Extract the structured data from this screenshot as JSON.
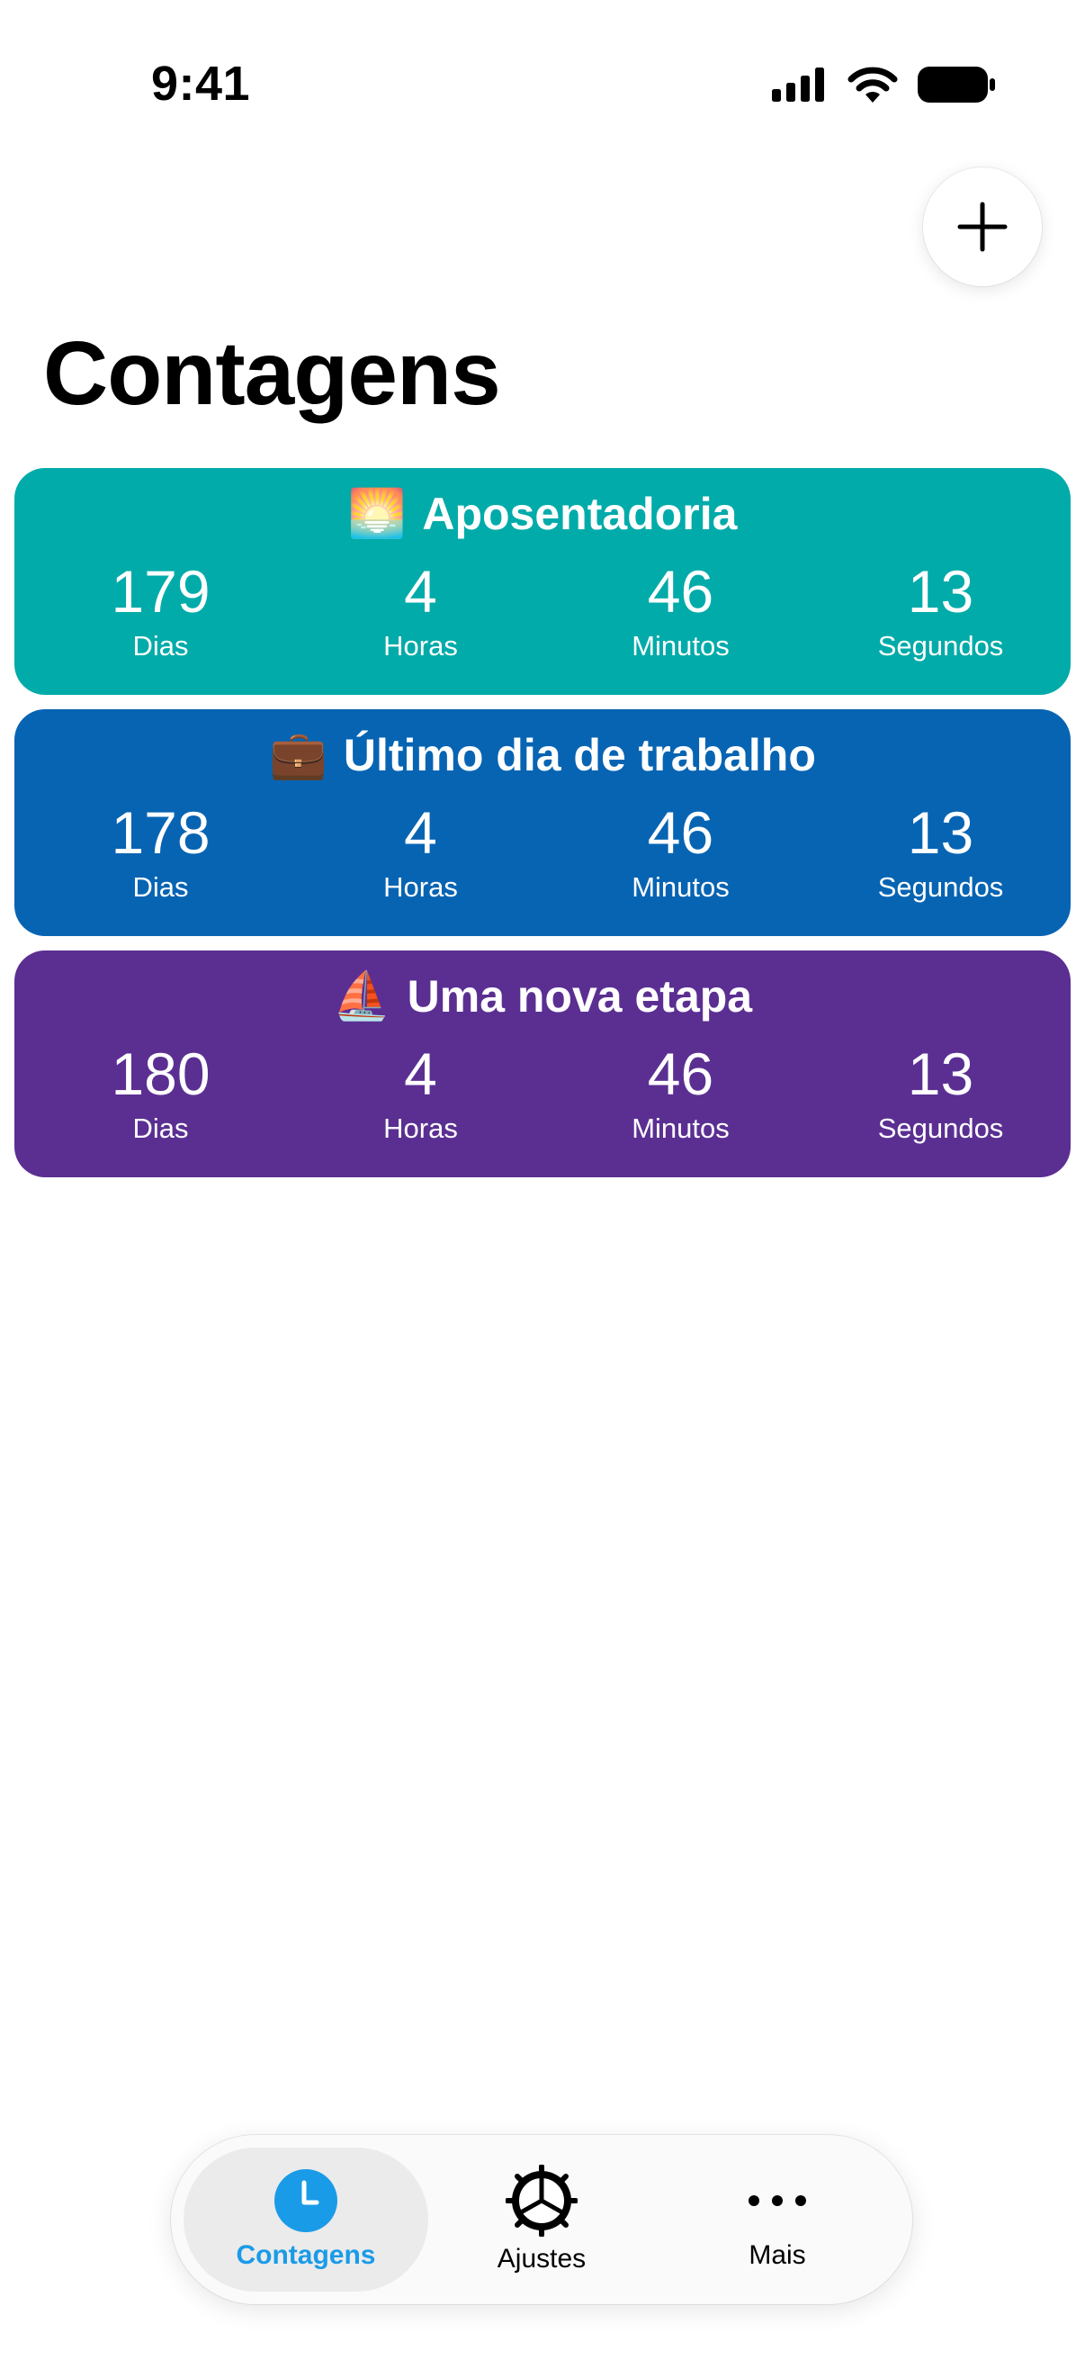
{
  "status_bar": {
    "time": "9:41"
  },
  "header": {
    "title": "Contagens",
    "add_icon": "plus-icon"
  },
  "colors": {
    "teal": "#00ABA9",
    "blue": "#0764B3",
    "purple": "#5B2F92",
    "accent": "#1A9BE8"
  },
  "countdowns": [
    {
      "emoji": "🌅",
      "title": "Aposentadoria",
      "color": "#00ABA9",
      "units": [
        {
          "value": "179",
          "label": "Dias"
        },
        {
          "value": "4",
          "label": "Horas"
        },
        {
          "value": "46",
          "label": "Minutos"
        },
        {
          "value": "13",
          "label": "Segundos"
        }
      ]
    },
    {
      "emoji": "💼",
      "title": "Último dia de trabalho",
      "color": "#0764B3",
      "units": [
        {
          "value": "178",
          "label": "Dias"
        },
        {
          "value": "4",
          "label": "Horas"
        },
        {
          "value": "46",
          "label": "Minutos"
        },
        {
          "value": "13",
          "label": "Segundos"
        }
      ]
    },
    {
      "emoji": "⛵",
      "title": "Uma nova etapa",
      "color": "#5B2F92",
      "units": [
        {
          "value": "180",
          "label": "Dias"
        },
        {
          "value": "4",
          "label": "Horas"
        },
        {
          "value": "46",
          "label": "Minutos"
        },
        {
          "value": "13",
          "label": "Segundos"
        }
      ]
    }
  ],
  "tab_bar": {
    "tabs": [
      {
        "label": "Contagens",
        "icon": "clock-icon",
        "active": true
      },
      {
        "label": "Ajustes",
        "icon": "gear-icon",
        "active": false
      },
      {
        "label": "Mais",
        "icon": "ellipsis-icon",
        "active": false
      }
    ]
  }
}
